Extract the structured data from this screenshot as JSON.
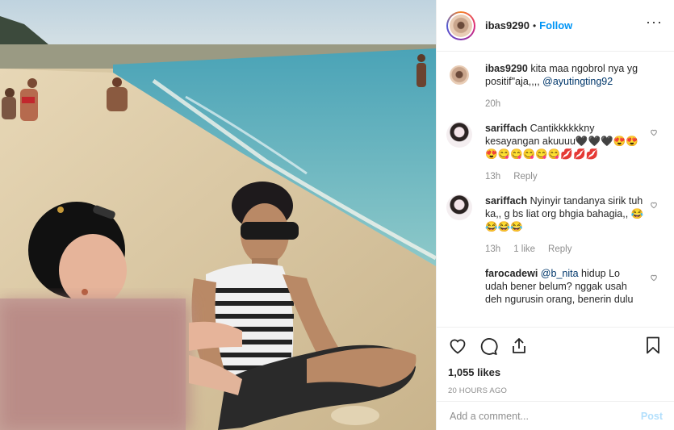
{
  "header": {
    "username": "ibas9290",
    "separator": "•",
    "follow_label": "Follow",
    "more_icon": "more-options-icon"
  },
  "caption": {
    "username": "ibas9290",
    "text": "kita maa ngobrol nya yg positif\"aja,,,,",
    "mention": "@ayutingting92",
    "time": "20h"
  },
  "comments": [
    {
      "username": "sariffach",
      "text": "Cantikkkkkkny kesayangan akuuuu🖤🖤🖤😍😍😍😋😋😋😋😋💋💋💋",
      "time": "13h",
      "likes": "",
      "reply": "Reply"
    },
    {
      "username": "sariffach",
      "text": "Nyinyir tandanya sirik tuh ka,, g bs liat org bhgia bahagia,, 😂😂😂😂",
      "time": "13h",
      "likes": "1 like",
      "reply": "Reply"
    },
    {
      "username": "farocadewi",
      "mention": "@b_nita",
      "text": "hidup Lo udah bener belum? nggak usah deh ngurusin orang, benerin dulu",
      "time": "",
      "likes": "",
      "reply": ""
    }
  ],
  "actions": {
    "likes": "1,055 likes",
    "time_ago": "20 HOURS AGO"
  },
  "composer": {
    "placeholder": "Add a comment...",
    "post_label": "Post"
  },
  "colors": {
    "accent": "#0095f6",
    "post_disabled": "#b2dffc",
    "muted": "#8e8e8e"
  }
}
